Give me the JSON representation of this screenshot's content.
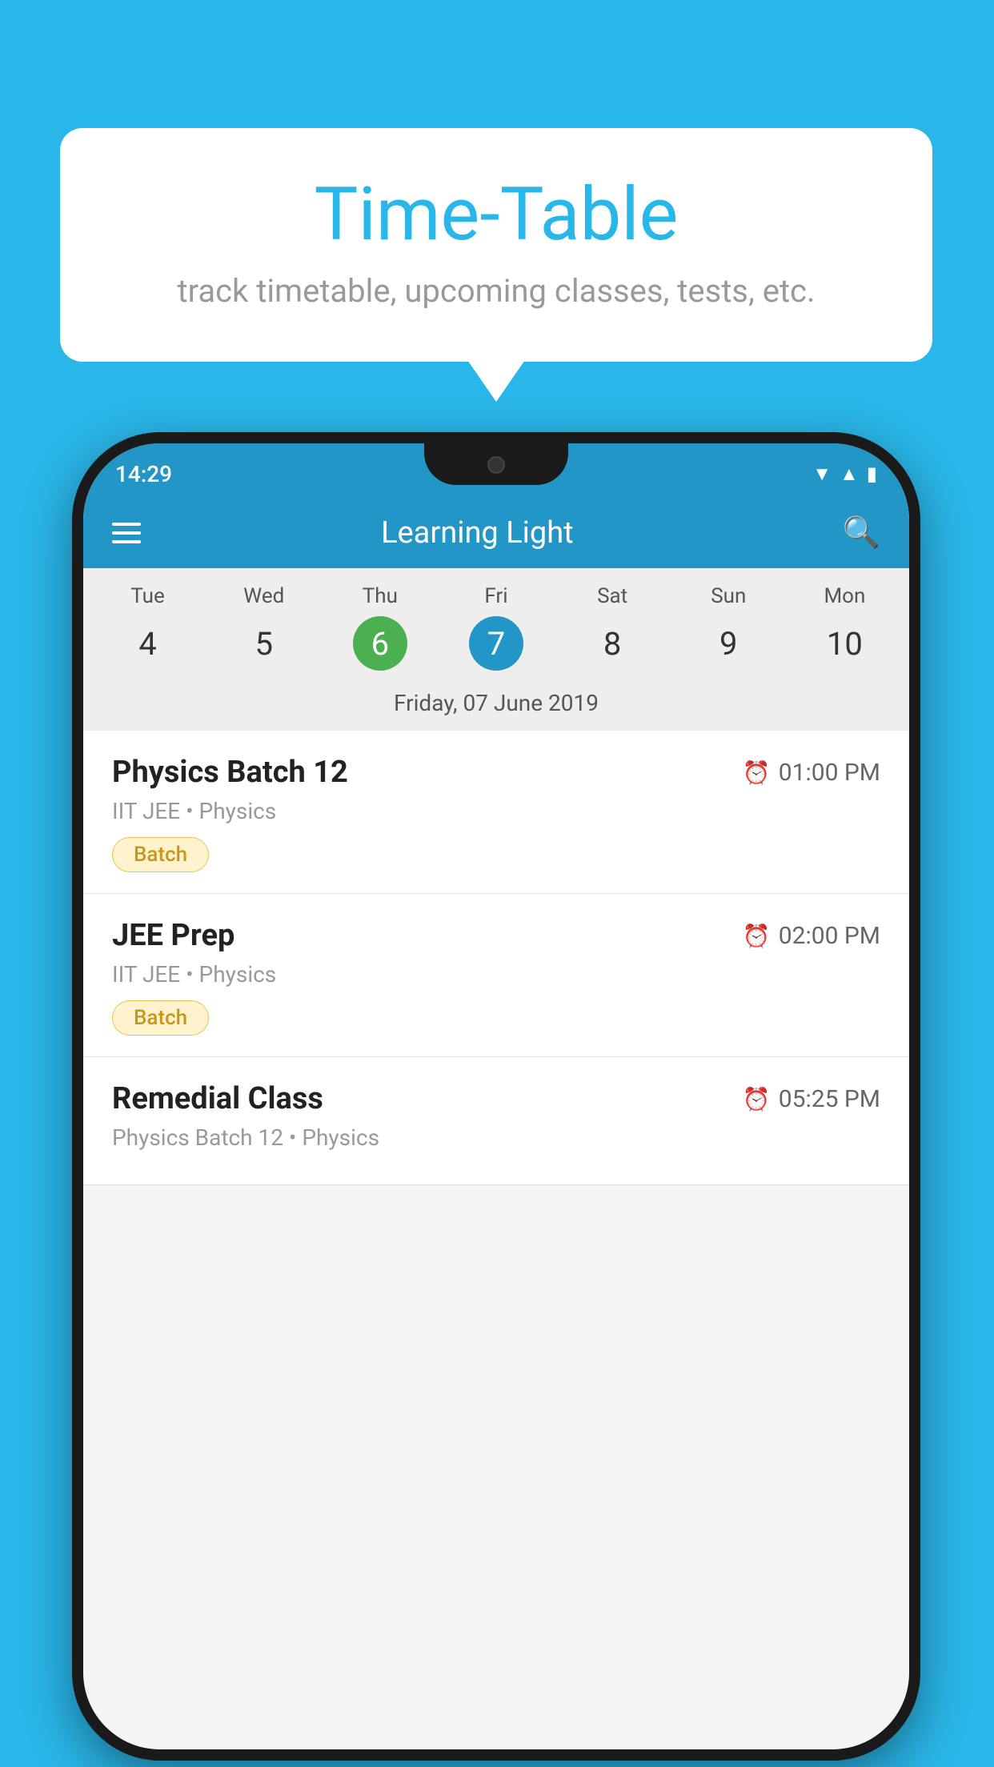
{
  "background_color": "#29b6e8",
  "tooltip": {
    "title": "Time-Table",
    "subtitle": "track timetable, upcoming classes, tests, etc."
  },
  "status_bar": {
    "time": "14:29"
  },
  "app_bar": {
    "title": "Learning Light"
  },
  "calendar": {
    "days_of_week": [
      "Tue",
      "Wed",
      "Thu",
      "Fri",
      "Sat",
      "Sun",
      "Mon"
    ],
    "dates": [
      "4",
      "5",
      "6",
      "7",
      "8",
      "9",
      "10"
    ],
    "today_index": 2,
    "selected_index": 3,
    "selected_label": "Friday, 07 June 2019"
  },
  "schedule": [
    {
      "title": "Physics Batch 12",
      "time": "01:00 PM",
      "sub": "IIT JEE • Physics",
      "badge": "Batch"
    },
    {
      "title": "JEE Prep",
      "time": "02:00 PM",
      "sub": "IIT JEE • Physics",
      "badge": "Batch"
    },
    {
      "title": "Remedial Class",
      "time": "05:25 PM",
      "sub": "Physics Batch 12 • Physics",
      "badge": ""
    }
  ]
}
